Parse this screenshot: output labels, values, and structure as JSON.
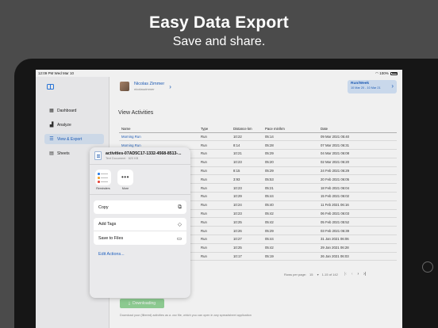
{
  "hero": {
    "title": "Easy Data Export",
    "subtitle": "Save and share."
  },
  "status_bar": {
    "time": "12:09 PM",
    "date": "Wed Mar 10",
    "battery": "100%"
  },
  "sidebar": {
    "items": [
      {
        "label": "Dashboard",
        "icon": "grid-icon",
        "active": false
      },
      {
        "label": "Analyze",
        "icon": "bar-chart-icon",
        "active": false
      },
      {
        "label": "View & Export",
        "icon": "list-icon",
        "active": true
      },
      {
        "label": "Sheets",
        "icon": "table-icon",
        "active": false
      }
    ]
  },
  "profile": {
    "name": "Nicolas Zimmer",
    "username": "nicolaszimmer"
  },
  "period": {
    "title": "Run/Week",
    "range": "10 Mar 20 - 10 Mar 21"
  },
  "main": {
    "section_title": "View Activities"
  },
  "table": {
    "headers": [
      "Name",
      "Type",
      "Distance km",
      "Pace min/km",
      "Date"
    ],
    "rows": [
      [
        "Morning Run",
        "Run",
        "10:22",
        "05:14",
        "09 Mar 2021 05:40"
      ],
      [
        "Morning Run",
        "Run",
        "8:14",
        "05:28",
        "07 Mar 2021 06:31"
      ],
      [
        "",
        "Run",
        "10:21",
        "05:29",
        "04 Mar 2021 06:08"
      ],
      [
        "",
        "Run",
        "10:23",
        "05:20",
        "02 Mar 2021 06:20"
      ],
      [
        "",
        "Run",
        "8:15",
        "05:29",
        "24 Feb 2021 06:29"
      ],
      [
        "",
        "Run",
        "3:93",
        "05:53",
        "20 Feb 2021 06:05"
      ],
      [
        "",
        "Run",
        "10:23",
        "05:21",
        "18 Feb 2021 06:04"
      ],
      [
        "",
        "Run",
        "10:29",
        "05:44",
        "15 Feb 2021 06:02"
      ],
      [
        "",
        "Run",
        "10:24",
        "05:40",
        "11 Feb 2021 06:16"
      ],
      [
        "",
        "Run",
        "10:23",
        "05:42",
        "06 Feb 2021 06:03"
      ],
      [
        "",
        "Run",
        "10:25",
        "05:42",
        "05 Feb 2021 05:52"
      ],
      [
        "",
        "Run",
        "10:26",
        "05:29",
        "03 Feb 2021 06:39"
      ],
      [
        "",
        "Run",
        "10:27",
        "05:44",
        "31 Jan 2021 06:06"
      ],
      [
        "",
        "Run",
        "10:25",
        "05:42",
        "29 Jan 2021 06:28"
      ],
      [
        "",
        "Run",
        "10:17",
        "05:19",
        "26 Jan 2021 06:03"
      ]
    ]
  },
  "pager": {
    "rows_label": "Rows per page:",
    "rows_value": "15",
    "range": "1-15 of 142",
    "first": "|‹",
    "prev": "‹",
    "next": "›",
    "last": "›|"
  },
  "download": {
    "button_label": "Downloading",
    "note": "Download your (filtered) activities as a .csv file, which you can open in any spreadsheet application"
  },
  "share_sheet": {
    "file_name": "activities-07AD5C17-1332-4568-8513-...",
    "file_meta": "Text Document · 620 KB",
    "apps": [
      {
        "label": "Reminders",
        "icon": "reminders-icon"
      },
      {
        "label": "More",
        "icon": "more-icon"
      }
    ],
    "actions_group1": [
      {
        "label": "Copy",
        "icon": "copy-icon"
      },
      {
        "label": "Add Tags",
        "icon": "tag-icon"
      },
      {
        "label": "Save to Files",
        "icon": "folder-icon"
      }
    ],
    "edit_actions": "Edit Actions..."
  }
}
